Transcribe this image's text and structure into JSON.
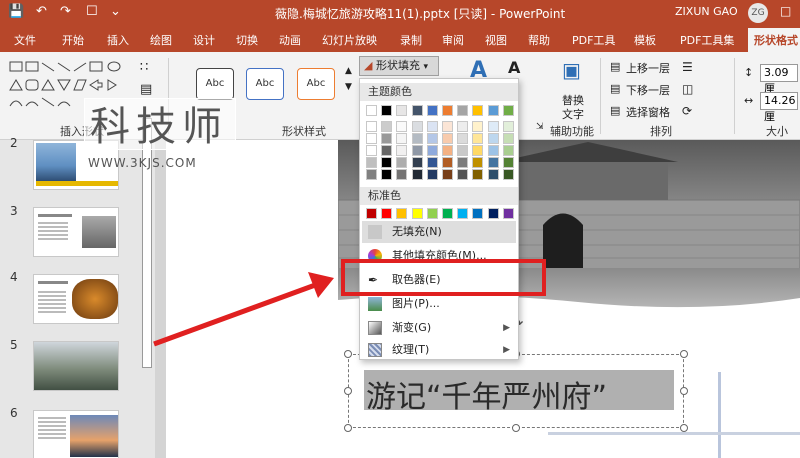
{
  "titlebar": {
    "title": "薇隐.梅城忆旅游攻略11(1).pptx [只读]  -  PowerPoint",
    "user": "ZIXUN GAO",
    "avatar": "ZG",
    "qa_icons": [
      "save-icon",
      "undo-icon",
      "redo-icon",
      "present-icon",
      "customize-icon"
    ]
  },
  "tabs": [
    "文件",
    "开始",
    "插入",
    "绘图",
    "设计",
    "切换",
    "动画",
    "幻灯片放映",
    "录制",
    "审阅",
    "视图",
    "帮助",
    "PDF工具",
    "模板",
    "PDF工具集",
    "形状格式"
  ],
  "ribbon": {
    "insert_shapes_label": "插入形状",
    "shape_styles_label": "形状样式",
    "shape_style_sample": "Abc",
    "fill_button": "形状填充",
    "replace_text": [
      "替换",
      "文字"
    ],
    "aux_label": "辅助功能",
    "bring_forward": "上移一层",
    "send_backward": "下移一层",
    "selection_pane": "选择窗格",
    "arrange_label": "排列",
    "height": "3.09 厘",
    "width": "14.26 厘",
    "size_label": "大小"
  },
  "watermark": {
    "main": "科技师",
    "sub": "WWW.3KJS.COM"
  },
  "slides": [
    "2",
    "3",
    "4",
    "5",
    "6"
  ],
  "dropdown": {
    "theme_colors_header": "主题颜色",
    "standard_colors_header": "标准色",
    "no_fill": "无填充(N)",
    "more_colors": "其他填充颜色(M)...",
    "eyedropper": "取色器(E)",
    "picture": "图片(P)...",
    "gradient": "渐变(G)",
    "texture": "纹理(T)",
    "theme_colors": [
      "#ffffff",
      "#000000",
      "#e7e6e6",
      "#44546a",
      "#4472c4",
      "#ed7d31",
      "#a5a5a5",
      "#ffc000",
      "#5b9bd5",
      "#70ad47"
    ],
    "standard_colors": [
      "#c00000",
      "#ff0000",
      "#ffc000",
      "#ffff00",
      "#92d050",
      "#00b050",
      "#00b0f0",
      "#0070c0",
      "#002060",
      "#7030a0"
    ]
  },
  "slide_text": "游记“千年严州府”"
}
